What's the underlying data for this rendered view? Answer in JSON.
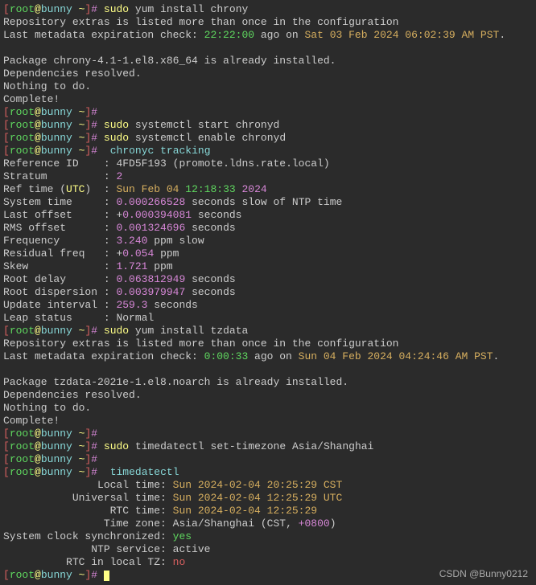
{
  "prompt": {
    "open": "[",
    "user": "root",
    "at": "@",
    "host": "bunny",
    "dir": " ~",
    "close": "]",
    "hash": "# "
  },
  "cmds": {
    "sudo": "sudo",
    "yum_install_chrony": " yum install chrony",
    "systemctl_start_chronyd": " systemctl start chronyd",
    "systemctl_enable_chronyd": " systemctl enable chronyd",
    "chronyc_tracking": " chronyc tracking",
    "yum_install_tzdata": " yum install tzdata",
    "timedatectl_settz": " timedatectl set-timezone Asia/Shanghai",
    "timedatectl": " timedatectl"
  },
  "out": {
    "repo_listed": "Repository extras is listed more than once in the configuration",
    "meta_pre": "Last metadata expiration check: ",
    "meta1_time": "22:22:00",
    "meta1_mid": " ago on ",
    "meta1_date": "Sat 03 Feb 2024 06:02:39 AM PST",
    "dot": ".",
    "blank": " ",
    "pkg_chrony": "Package chrony-4.1-1.el8.x86_64 is already installed.",
    "deps": "Dependencies resolved.",
    "nothing": "Nothing to do.",
    "complete": "Complete!",
    "tr_refid_l": "Reference ID    : ",
    "tr_refid_v": "4FD5F193",
    "tr_refid_paren": " (promote.ldns.rate.local)",
    "tr_stratum_l": "Stratum         : ",
    "tr_stratum_v": "2",
    "tr_reftime_l": "Ref time (",
    "tr_reftime_utc": "UTC",
    "tr_reftime_l2": ")  : ",
    "tr_reftime_day": "Sun Feb 04",
    "tr_reftime_sp": " ",
    "tr_reftime_time": "12:18:33",
    "tr_reftime_yr": "2024",
    "tr_sys_l": "System time     : ",
    "tr_sys_v": "0.000266528",
    "tr_sys_t": " seconds slow of NTP time",
    "tr_lastoff_l": "Last offset     : ",
    "tr_lastoff_s": "+",
    "tr_lastoff_v": "0.000394081",
    "tr_sec": " seconds",
    "tr_rms_l": "RMS offset      : ",
    "tr_rms_v": "0.001324696",
    "tr_freq_l": "Frequency       : ",
    "tr_freq_v": "3.240",
    "tr_freq_t": " ppm slow",
    "tr_resfreq_l": "Residual freq   : ",
    "tr_resfreq_s": "+",
    "tr_resfreq_v": "0.054",
    "tr_ppm": " ppm",
    "tr_skew_l": "Skew            : ",
    "tr_skew_v": "1.721",
    "tr_rootdel_l": "Root delay      : ",
    "tr_rootdel_v": "0.063812949",
    "tr_rootdisp_l": "Root dispersion : ",
    "tr_rootdisp_v": "0.003979947",
    "tr_upd_l": "Update interval : ",
    "tr_upd_v": "259.3",
    "tr_leap_l": "Leap status     : ",
    "tr_leap_v": "Normal",
    "meta2_time": "0:00:33",
    "meta2_date": "Sun 04 Feb 2024 04:24:46 AM PST",
    "pkg_tzdata": "Package tzdata-2021e-1.el8.noarch is already installed.",
    "td_local_l": "               Local time: ",
    "td_local_v": "Sun 2024-02-04 20:25:29 CST",
    "td_univ_l": "           Universal time: ",
    "td_univ_v": "Sun 2024-02-04 12:25:29 UTC",
    "td_rtc_l": "                 RTC time: ",
    "td_rtc_v": "Sun 2024-02-04 12:25:29",
    "td_zone_l": "                Time zone: ",
    "td_zone_v1": "Asia/Shanghai (CST, ",
    "td_zone_v2": "+0800",
    "td_zone_v3": ")",
    "td_sync_l": "System clock synchronized: ",
    "td_sync_v": "yes",
    "td_ntp_l": "              NTP service: ",
    "td_ntp_v": "active",
    "td_rtctz_l": "          RTC in local TZ: ",
    "td_rtctz_v": "no"
  },
  "watermark": "CSDN @Bunny0212"
}
